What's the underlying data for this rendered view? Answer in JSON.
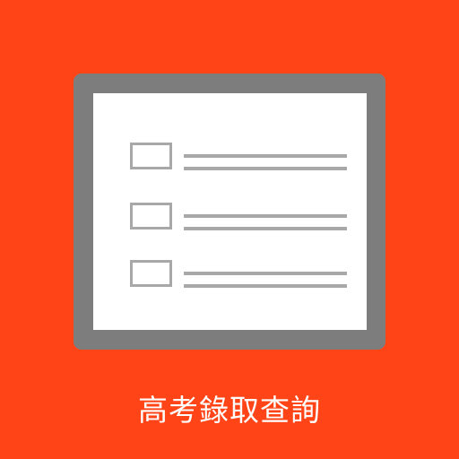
{
  "app": {
    "caption": "高考錄取查詢"
  },
  "icon": {
    "name": "checklist-document-icon",
    "background_color": "#FF4517",
    "frame_color": "#7D7D7D",
    "sheet_color": "#FFFFFF",
    "item_color": "#A8A8A8",
    "caption_color": "#FFFFFF",
    "list_items": 3
  }
}
